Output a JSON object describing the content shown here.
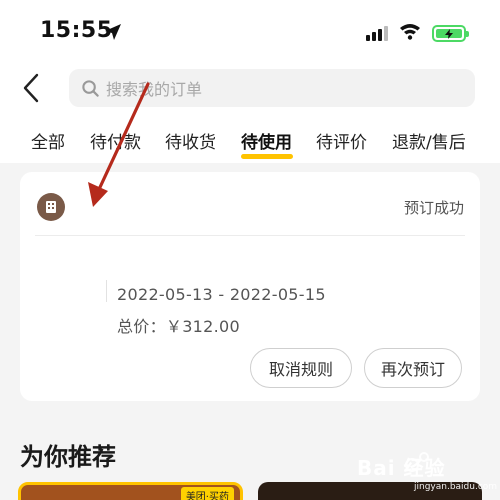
{
  "status_bar": {
    "time": "15:55"
  },
  "search": {
    "placeholder": "搜索我的订单"
  },
  "tabs": [
    {
      "label": "全部"
    },
    {
      "label": "待付款"
    },
    {
      "label": "待收货"
    },
    {
      "label": "待使用",
      "active": true
    },
    {
      "label": "待评价"
    },
    {
      "label": "退款/售后"
    }
  ],
  "order": {
    "status": "预订成功",
    "dates": "2022-05-13 - 2022-05-15",
    "price": "总价：￥312.00",
    "buttons": {
      "cancel_rule": "取消规则",
      "rebook": "再次预订"
    }
  },
  "recommend": {
    "title": "为你推荐",
    "card1_badge": "美团·买药"
  },
  "watermark": {
    "text": "Bai 经验",
    "url": "jingyan.baidu.com"
  },
  "colors": {
    "accent": "#ffc300",
    "battery": "#4cd964",
    "hotel_icon": "#7a5a48",
    "annotation_arrow": "#b52a1c"
  }
}
